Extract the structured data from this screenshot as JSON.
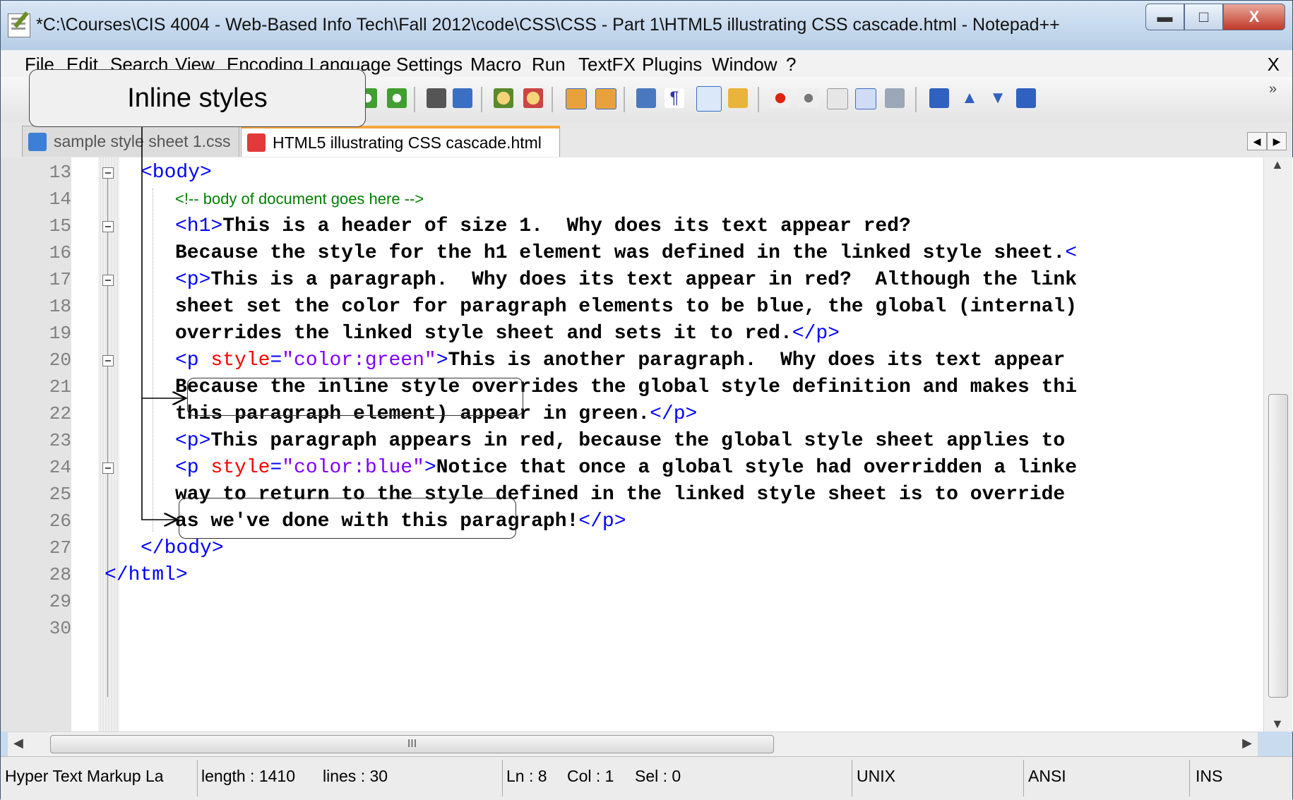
{
  "window": {
    "title": "*C:\\Courses\\CIS 4004 - Web-Based Info Tech\\Fall 2012\\code\\CSS\\CSS - Part 1\\HTML5 illustrating CSS cascade.html - Notepad++"
  },
  "menu": {
    "items": [
      "File",
      "Edit",
      "Search",
      "View",
      "Encoding",
      "Language",
      "Settings",
      "Macro",
      "Run",
      "TextFX",
      "Plugins",
      "Window",
      "?"
    ],
    "close_label": "X"
  },
  "toolbar": {
    "overflow": "»"
  },
  "tabs": [
    {
      "label": "sample style sheet 1.css",
      "icon": "save-icon-blue",
      "active": false
    },
    {
      "label": "HTML5 illustrating CSS cascade.html",
      "icon": "save-icon-red",
      "active": true
    }
  ],
  "editor": {
    "line_numbers": [
      "13",
      "14",
      "15",
      "16",
      "17",
      "18",
      "19",
      "20",
      "21",
      "22",
      "23",
      "24",
      "25",
      "26",
      "27",
      "28",
      "29",
      "30"
    ]
  },
  "callout": {
    "label": "Inline styles"
  },
  "scrollbar": {
    "h_grip": "III"
  },
  "status": {
    "language": "Hyper Text Markup La",
    "length": "length : 1410",
    "lines": "lines : 30",
    "ln": "Ln : 8",
    "col": "Col : 1",
    "sel": "Sel : 0",
    "eol": "UNIX",
    "encoding": "ANSI",
    "mode": "INS"
  },
  "colors": {
    "tag": "#0000ff",
    "attribute": "#ff0000",
    "value": "#8000ff",
    "comment": "#008000",
    "active_tab_accent": "#f4a53c"
  }
}
